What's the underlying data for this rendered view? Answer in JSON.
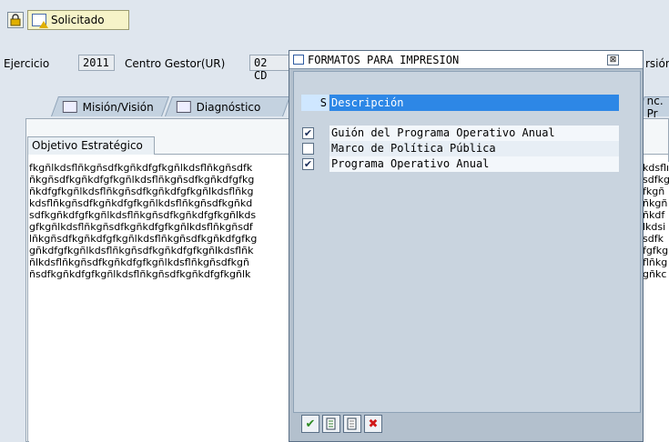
{
  "toolbar": {
    "status_button_label": "Solicitado"
  },
  "header": {
    "ejercicio_label": "Ejercicio",
    "ejercicio_value": "2011",
    "centro_label": "Centro Gestor(UR)",
    "centro_value": "02 CD",
    "version_partial": "rsión"
  },
  "tabs": [
    {
      "label": "Misión/Visión"
    },
    {
      "label": "Diagnóstico"
    },
    {
      "label": "nc. Pr"
    }
  ],
  "group": {
    "label": "Objetivo Estratégico",
    "left_lines": [
      "fkgñlkdsflñkgñsdfkgñkdfgfkgñlkdsflñkgñsdfk",
      "ñkgñsdfkgñkdfgfkgñlkdsflñkgñsdfkgñkdfgfkg",
      "ñkdfgfkgñlkdsflñkgñsdfkgñkdfgfkgñlkdsflñkg",
      "kdsflñkgñsdfkgñkdfgfkgñlkdsflñkgñsdfkgñkd",
      "sdfkgñkdfgfkgñlkdsflñkgñsdfkgñkdfgfkgñlkds",
      "gfkgñlkdsflñkgñsdfkgñkdfgfkgñlkdsflñkgñsdf",
      "lñkgñsdfkgñkdfgfkgñlkdsflñkgñsdfkgñkdfgfkg",
      "gñkdfgfkgñlkdsflñkgñsdfkgñkdfgfkgñlkdsflñk",
      "ñlkdsflñkgñsdfkgñkdfgfkgñlkdsflñkgñsdfkgñ",
      "ñsdfkgñkdfgfkgñlkdsflñkgñsdfkgñkdfgfkgñlk"
    ],
    "right_lines": [
      "kdsflı",
      "sdfkg",
      "fkgñ",
      "ñkgñ",
      "ñkdf",
      "lkdsi",
      "sdfk",
      "fgfkg",
      "flñkg",
      "gñkc"
    ]
  },
  "dialog": {
    "title": "FORMATOS PARA IMPRESION",
    "close_glyph": "⊠",
    "col_s": "S",
    "col_desc": "Descripción",
    "rows": [
      {
        "label": "Guión del Programa Operativo Anual",
        "checked": true
      },
      {
        "label": "Marco de Política Pública",
        "checked": false
      },
      {
        "label": "Programa Operativo Anual",
        "checked": true
      }
    ]
  },
  "icons": {
    "lock": "lock-icon",
    "status": "warning-document-icon",
    "ok": "check-icon",
    "cancel": "cancel-icon"
  },
  "colors": {
    "header_bg": "#2d87e6",
    "status_bg": "#f6f3c8",
    "cancel": "#d01818",
    "ok": "#2e8b22"
  }
}
